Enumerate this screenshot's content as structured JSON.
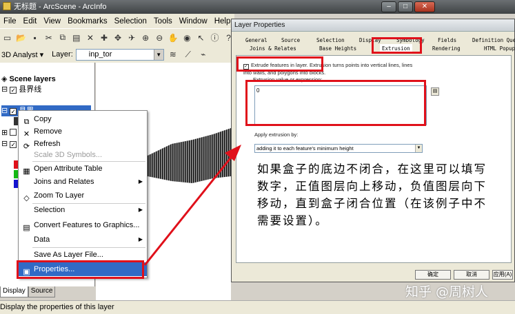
{
  "window": {
    "title": "无标题 - ArcScene - ArcInfo",
    "btn_min": "–",
    "btn_max": "□",
    "btn_close": "✕"
  },
  "menubar": [
    "File",
    "Edit",
    "View",
    "Bookmarks",
    "Selection",
    "Tools",
    "Window",
    "Help"
  ],
  "toolbar2": {
    "analyst_label": "3D Analyst ▾",
    "layer_label": "Layer:",
    "layer_value": "inp_tor"
  },
  "toc": {
    "title": "Scene layers",
    "layer1": "县界线",
    "layer2": "县界"
  },
  "toc_tabs": [
    "Display",
    "Source"
  ],
  "status": "Display the properties of this layer",
  "context_menu": {
    "copy": "Copy",
    "remove": "Remove",
    "refresh": "Refresh",
    "scale3d": "Scale 3D Symbols...",
    "open_table": "Open Attribute Table",
    "joins": "Joins and Relates",
    "zoom": "Zoom To Layer",
    "selection": "Selection",
    "convert": "Convert Features to Graphics...",
    "data": "Data",
    "save": "Save As Layer File...",
    "properties": "Properties..."
  },
  "dialog": {
    "title": "Layer Properties",
    "tabs_row1": [
      "General",
      "Source",
      "Selection",
      "Display",
      "Symbology",
      "Fields",
      "Definition Query"
    ],
    "tabs_row2": [
      "Joins & Relates",
      "Base Heights",
      "Extrusion",
      "Rendering",
      "HTML Popup"
    ],
    "extrude_check": "Extrude features in layer. Extrusion turns points into vertical lines, lines into walls, and polygons into blocks.",
    "expr_label": "Extrusion value or expression:",
    "expr_value": "0",
    "apply_label": "Apply extrusion by:",
    "apply_value": "adding it to each feature's minimum height",
    "ok": "确定",
    "cancel": "取消",
    "apply": "应用(A)"
  },
  "annotation": "如果盒子的底边不闭合，在这里可以填写数字，正值图层向上移动，负值图层向下移动，直到盒子闭合位置（在该例子中不需要设置）。",
  "watermark": "知乎 @周树人",
  "colors": {
    "highlight_red": "#e0101a",
    "selection_blue": "#316ac5"
  }
}
